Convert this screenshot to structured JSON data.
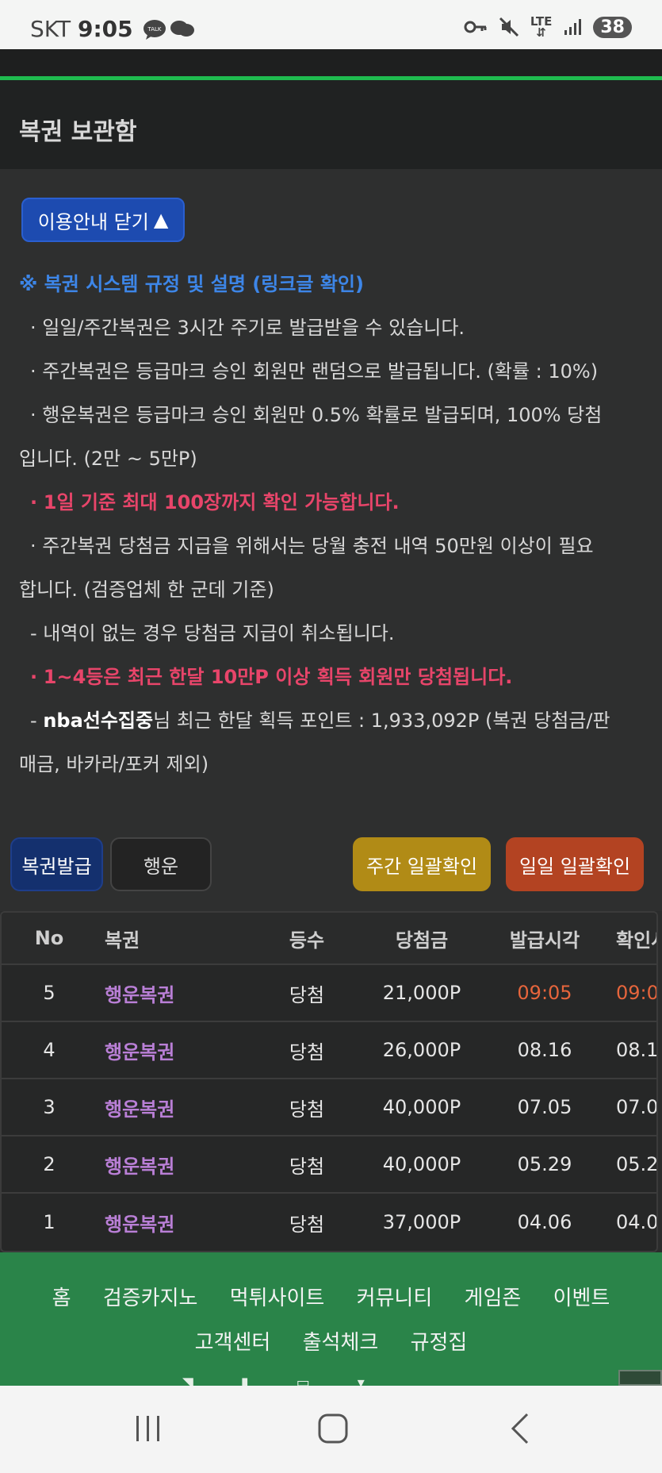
{
  "status_bar": {
    "carrier": "SKT",
    "time": "9:05",
    "network": "LTE",
    "battery": "38"
  },
  "header": {
    "title": "복권 보관함"
  },
  "guide_button": {
    "label": "이용안내 닫기"
  },
  "rules": {
    "heading": "※ 복권 시스템 규정 및 설명 (링크글 확인)",
    "line1": "· 일일/주간복권은 3시간 주기로 발급받을 수 있습니다.",
    "line2": "· 주간복권은 등급마크 승인 회원만 랜덤으로 발급됩니다. (확률 : 10%)",
    "line3a": "· 행운복권은 등급마크 승인 회원만 0.5% 확률로 발급되며, 100% 당첨",
    "line3b": "입니다. (2만 ~ 5만P)",
    "line4_bullet": "·",
    "line4": "1일 기준 최대 100장까지 확인 가능합니다.",
    "line5a": "· 주간복권 당첨금 지급을 위해서는 당월 충전 내역 50만원 이상이 필요",
    "line5b": "합니다. (검증업체 한 군데 기준)",
    "line6": "- 내역이 없는 경우 당첨금 지급이 취소됩니다.",
    "line7_bullet": "·",
    "line7": "1~4등은 최근 한달 10만P 이상 획득 회원만 당첨됩니다.",
    "line8_prefix": "-",
    "line8_user": "nba선수집중",
    "line8_rest": "님 최근 한달 획득 포인트 : 1,933,092P (복권 당첨금/판",
    "line8b": "매금, 바카라/포커 제외)"
  },
  "actions": {
    "issue": "복권발급",
    "luck": "행운",
    "weekly_check": "주간 일괄확인",
    "daily_check": "일일 일괄확인"
  },
  "table": {
    "headers": {
      "no": "No",
      "name": "복권",
      "rank": "등수",
      "prize": "당첨금",
      "issued": "발급시각",
      "checked": "확인시"
    },
    "rows": [
      {
        "no": "5",
        "name": "행운복권",
        "rank": "당첨",
        "prize": "21,000P",
        "issued": "09:05",
        "checked": "09:0"
      },
      {
        "no": "4",
        "name": "행운복권",
        "rank": "당첨",
        "prize": "26,000P",
        "issued": "08.16",
        "checked": "08.1"
      },
      {
        "no": "3",
        "name": "행운복권",
        "rank": "당첨",
        "prize": "40,000P",
        "issued": "07.05",
        "checked": "07.0"
      },
      {
        "no": "2",
        "name": "행운복권",
        "rank": "당첨",
        "prize": "40,000P",
        "issued": "05.29",
        "checked": "05.2"
      },
      {
        "no": "1",
        "name": "행운복권",
        "rank": "당첨",
        "prize": "37,000P",
        "issued": "04.06",
        "checked": "04.0"
      }
    ]
  },
  "footer": {
    "nav": [
      "홈",
      "검증카지노",
      "먹튀사이트",
      "커뮤니티",
      "게임존",
      "이벤트",
      "고객센터",
      "출석체크",
      "규정집"
    ]
  },
  "colors": {
    "accent_green": "#1fbb4f",
    "footer_green": "#2a8449",
    "primary_blue": "#1d4bb0",
    "warning_red": "#e8456a",
    "lotto_purple": "#b97fd6"
  }
}
